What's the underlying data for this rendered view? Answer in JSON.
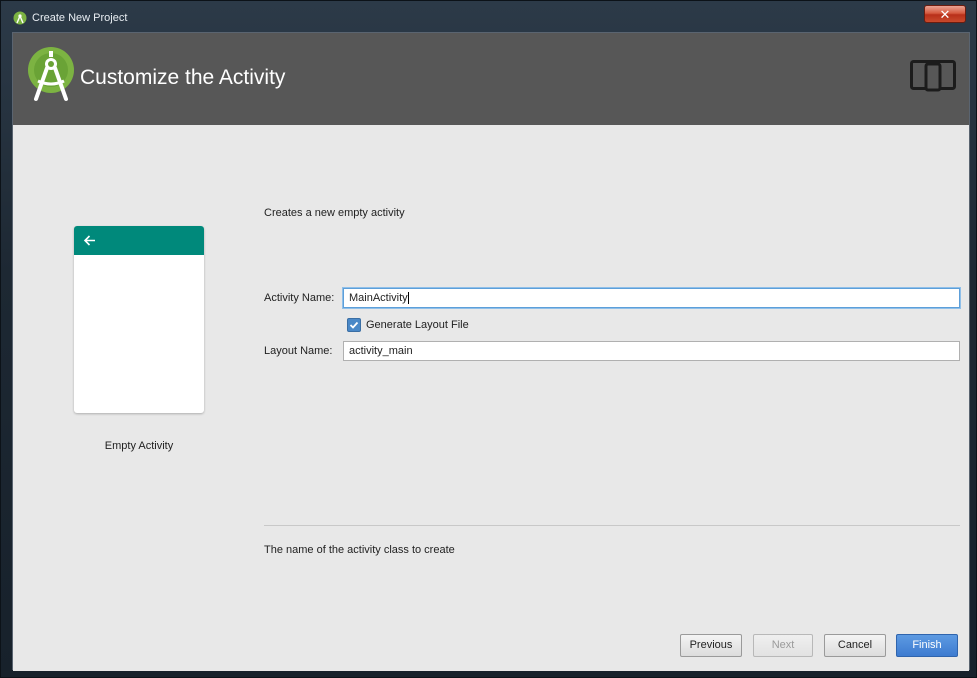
{
  "window": {
    "title": "Create New Project",
    "close_glyph": "✕"
  },
  "header": {
    "title": "Customize the Activity",
    "logo_icon": "android-studio-icon",
    "device_icon": "tablet-phone-icon"
  },
  "preview": {
    "label": "Empty Activity",
    "appbar_color": "#00897b"
  },
  "form": {
    "description": "Creates a new empty activity",
    "activity_name_label": "Activity Name:",
    "activity_name_value": "MainActivity",
    "generate_layout_label": "Generate Layout File",
    "generate_layout_checked": true,
    "layout_name_label": "Layout Name:",
    "layout_name_value": "activity_main",
    "help_text": "The name of the activity class to create"
  },
  "buttons": {
    "previous": "Previous",
    "next": "Next",
    "cancel": "Cancel",
    "finish": "Finish"
  },
  "colors": {
    "header_bg": "#575757",
    "content_bg": "#e8e8e8",
    "accent": "#4a88c7"
  }
}
